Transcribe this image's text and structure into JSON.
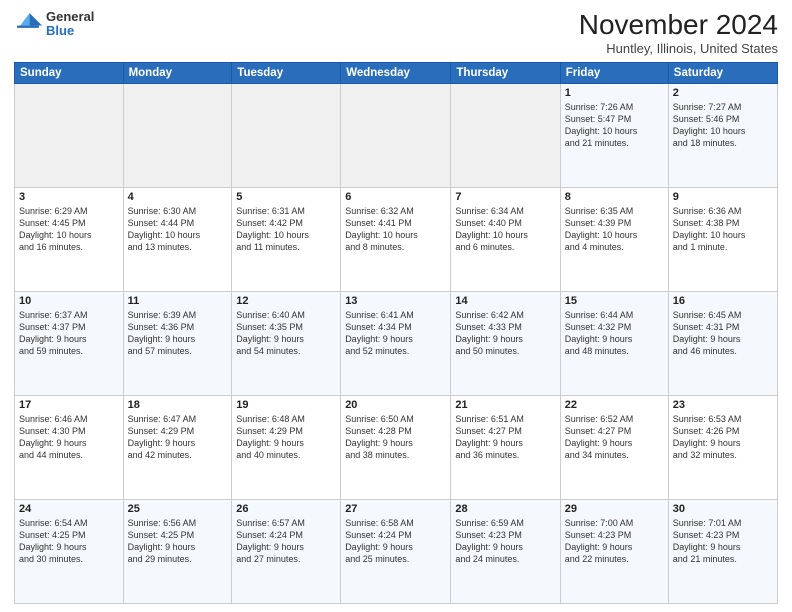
{
  "logo": {
    "general": "General",
    "blue": "Blue"
  },
  "header": {
    "month": "November 2024",
    "location": "Huntley, Illinois, United States"
  },
  "weekdays": [
    "Sunday",
    "Monday",
    "Tuesday",
    "Wednesday",
    "Thursday",
    "Friday",
    "Saturday"
  ],
  "weeks": [
    [
      {
        "day": "",
        "info": ""
      },
      {
        "day": "",
        "info": ""
      },
      {
        "day": "",
        "info": ""
      },
      {
        "day": "",
        "info": ""
      },
      {
        "day": "",
        "info": ""
      },
      {
        "day": "1",
        "info": "Sunrise: 7:26 AM\nSunset: 5:47 PM\nDaylight: 10 hours\nand 21 minutes."
      },
      {
        "day": "2",
        "info": "Sunrise: 7:27 AM\nSunset: 5:46 PM\nDaylight: 10 hours\nand 18 minutes."
      }
    ],
    [
      {
        "day": "3",
        "info": "Sunrise: 6:29 AM\nSunset: 4:45 PM\nDaylight: 10 hours\nand 16 minutes."
      },
      {
        "day": "4",
        "info": "Sunrise: 6:30 AM\nSunset: 4:44 PM\nDaylight: 10 hours\nand 13 minutes."
      },
      {
        "day": "5",
        "info": "Sunrise: 6:31 AM\nSunset: 4:42 PM\nDaylight: 10 hours\nand 11 minutes."
      },
      {
        "day": "6",
        "info": "Sunrise: 6:32 AM\nSunset: 4:41 PM\nDaylight: 10 hours\nand 8 minutes."
      },
      {
        "day": "7",
        "info": "Sunrise: 6:34 AM\nSunset: 4:40 PM\nDaylight: 10 hours\nand 6 minutes."
      },
      {
        "day": "8",
        "info": "Sunrise: 6:35 AM\nSunset: 4:39 PM\nDaylight: 10 hours\nand 4 minutes."
      },
      {
        "day": "9",
        "info": "Sunrise: 6:36 AM\nSunset: 4:38 PM\nDaylight: 10 hours\nand 1 minute."
      }
    ],
    [
      {
        "day": "10",
        "info": "Sunrise: 6:37 AM\nSunset: 4:37 PM\nDaylight: 9 hours\nand 59 minutes."
      },
      {
        "day": "11",
        "info": "Sunrise: 6:39 AM\nSunset: 4:36 PM\nDaylight: 9 hours\nand 57 minutes."
      },
      {
        "day": "12",
        "info": "Sunrise: 6:40 AM\nSunset: 4:35 PM\nDaylight: 9 hours\nand 54 minutes."
      },
      {
        "day": "13",
        "info": "Sunrise: 6:41 AM\nSunset: 4:34 PM\nDaylight: 9 hours\nand 52 minutes."
      },
      {
        "day": "14",
        "info": "Sunrise: 6:42 AM\nSunset: 4:33 PM\nDaylight: 9 hours\nand 50 minutes."
      },
      {
        "day": "15",
        "info": "Sunrise: 6:44 AM\nSunset: 4:32 PM\nDaylight: 9 hours\nand 48 minutes."
      },
      {
        "day": "16",
        "info": "Sunrise: 6:45 AM\nSunset: 4:31 PM\nDaylight: 9 hours\nand 46 minutes."
      }
    ],
    [
      {
        "day": "17",
        "info": "Sunrise: 6:46 AM\nSunset: 4:30 PM\nDaylight: 9 hours\nand 44 minutes."
      },
      {
        "day": "18",
        "info": "Sunrise: 6:47 AM\nSunset: 4:29 PM\nDaylight: 9 hours\nand 42 minutes."
      },
      {
        "day": "19",
        "info": "Sunrise: 6:48 AM\nSunset: 4:29 PM\nDaylight: 9 hours\nand 40 minutes."
      },
      {
        "day": "20",
        "info": "Sunrise: 6:50 AM\nSunset: 4:28 PM\nDaylight: 9 hours\nand 38 minutes."
      },
      {
        "day": "21",
        "info": "Sunrise: 6:51 AM\nSunset: 4:27 PM\nDaylight: 9 hours\nand 36 minutes."
      },
      {
        "day": "22",
        "info": "Sunrise: 6:52 AM\nSunset: 4:27 PM\nDaylight: 9 hours\nand 34 minutes."
      },
      {
        "day": "23",
        "info": "Sunrise: 6:53 AM\nSunset: 4:26 PM\nDaylight: 9 hours\nand 32 minutes."
      }
    ],
    [
      {
        "day": "24",
        "info": "Sunrise: 6:54 AM\nSunset: 4:25 PM\nDaylight: 9 hours\nand 30 minutes."
      },
      {
        "day": "25",
        "info": "Sunrise: 6:56 AM\nSunset: 4:25 PM\nDaylight: 9 hours\nand 29 minutes."
      },
      {
        "day": "26",
        "info": "Sunrise: 6:57 AM\nSunset: 4:24 PM\nDaylight: 9 hours\nand 27 minutes."
      },
      {
        "day": "27",
        "info": "Sunrise: 6:58 AM\nSunset: 4:24 PM\nDaylight: 9 hours\nand 25 minutes."
      },
      {
        "day": "28",
        "info": "Sunrise: 6:59 AM\nSunset: 4:23 PM\nDaylight: 9 hours\nand 24 minutes."
      },
      {
        "day": "29",
        "info": "Sunrise: 7:00 AM\nSunset: 4:23 PM\nDaylight: 9 hours\nand 22 minutes."
      },
      {
        "day": "30",
        "info": "Sunrise: 7:01 AM\nSunset: 4:23 PM\nDaylight: 9 hours\nand 21 minutes."
      }
    ]
  ]
}
